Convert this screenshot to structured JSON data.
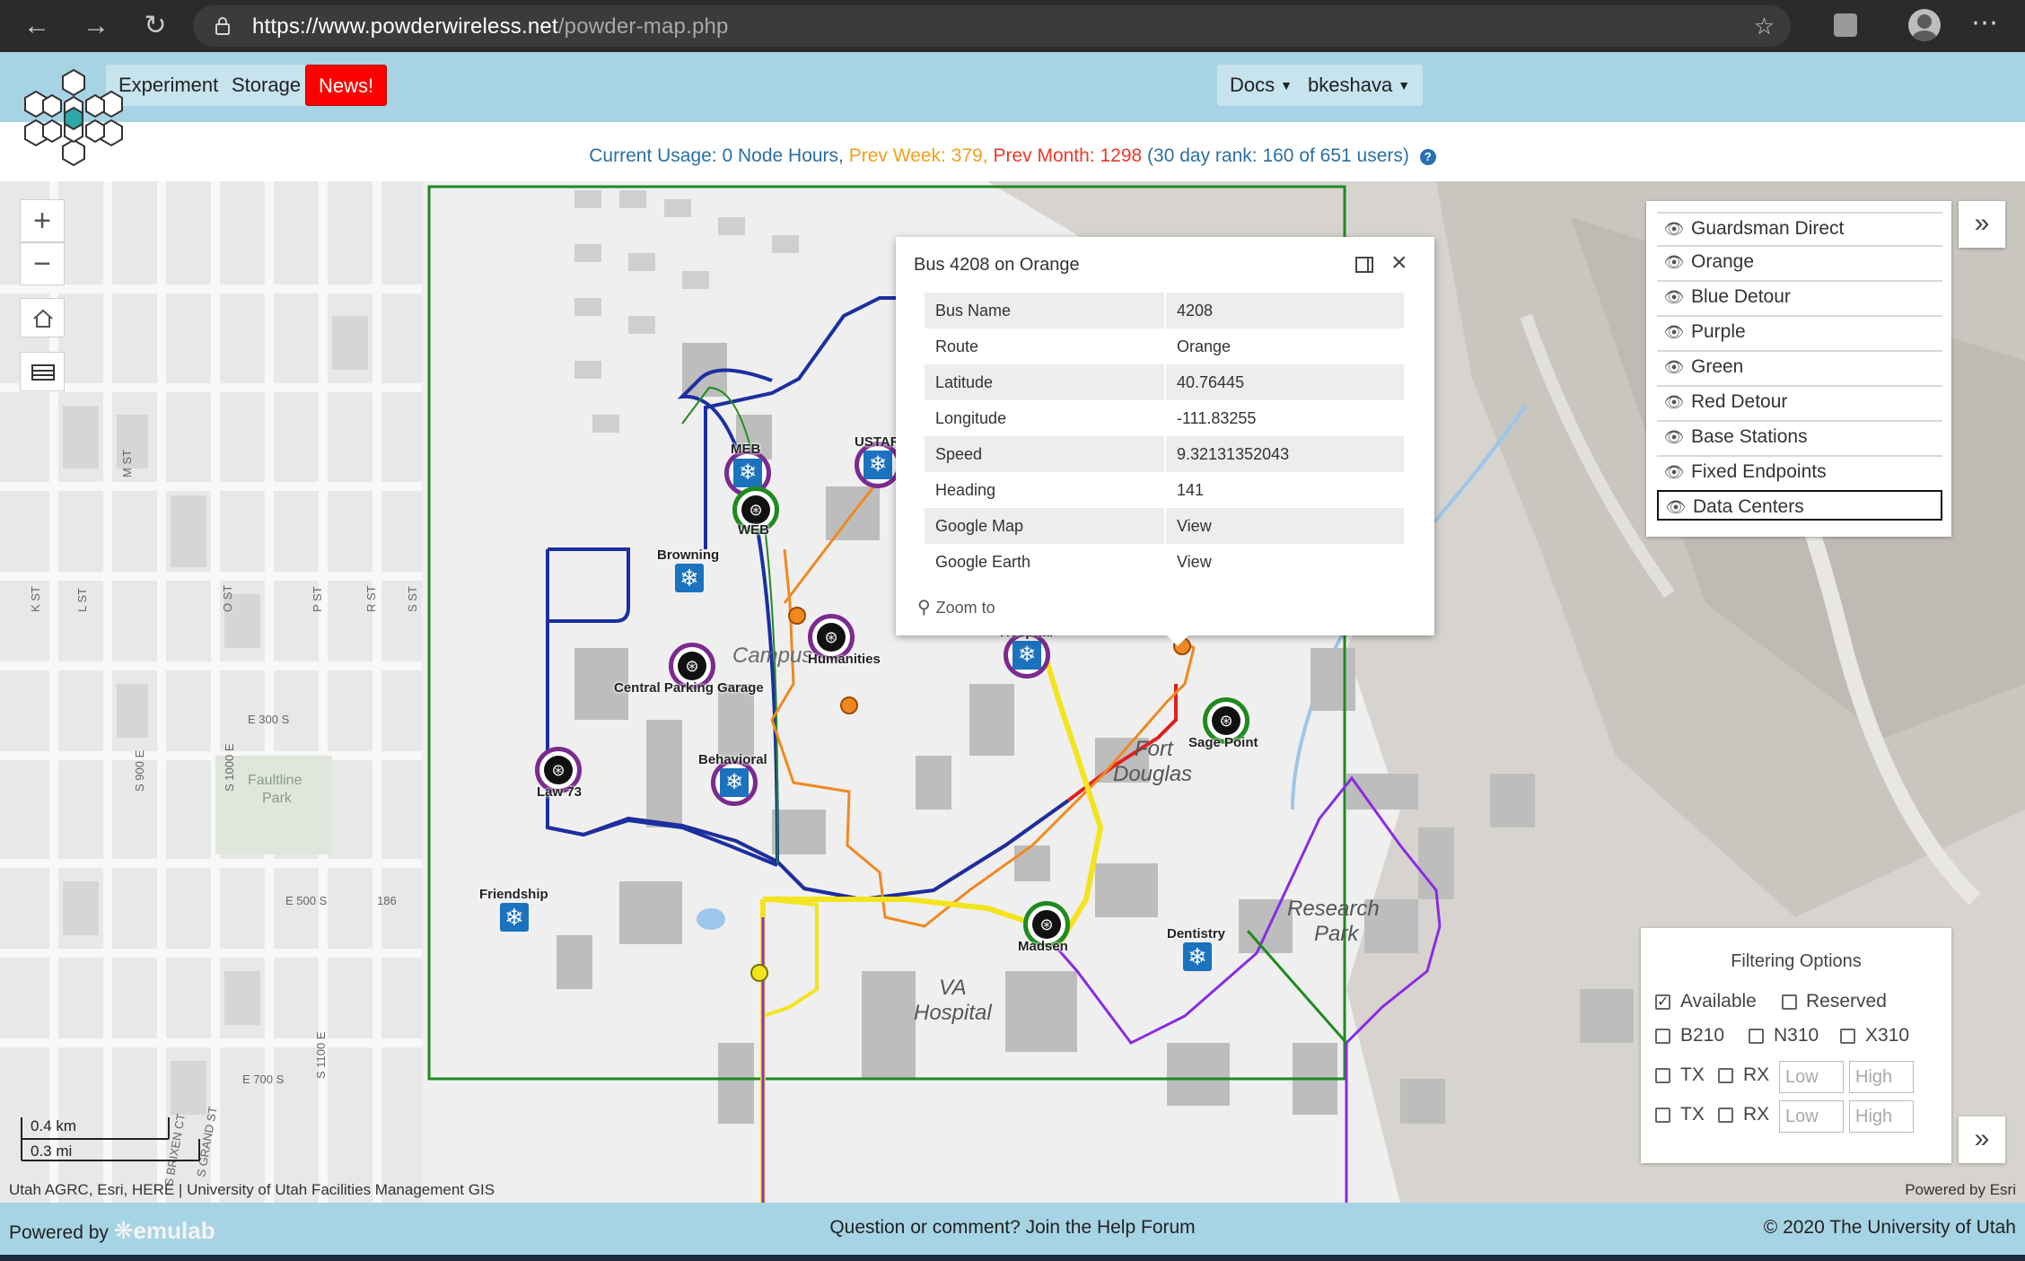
{
  "browser": {
    "url_host": "https://www.powderwireless.net",
    "url_path": "/powder-map.php"
  },
  "nav": {
    "experiments": "Experiments",
    "storage": "Storage",
    "news": "News!",
    "docs": "Docs",
    "user": "bkeshava"
  },
  "usage": {
    "current": "Current Usage: 0 Node Hours,",
    "prev_week": "Prev Week: 379,",
    "prev_month": "Prev Month: 1298",
    "rank": "(30 day rank: 160 of 651 users)"
  },
  "map": {
    "streets": [
      "M ST",
      "L ST",
      "K ST",
      "O ST",
      "P ST",
      "R ST",
      "S ST",
      "S 900 E",
      "S 1000 E",
      "E 300 S",
      "E 500 S",
      "S 1100 E",
      "E 700 S",
      "S BRIXEN CT",
      "S GRAND ST",
      "186"
    ],
    "areas": [
      "Faultline Park",
      "Fort Douglas",
      "Research Park",
      "VA Hospital",
      "Campus"
    ],
    "markers": [
      {
        "label": "MEB",
        "kind": "data-center"
      },
      {
        "label": "WEB",
        "kind": "base-station"
      },
      {
        "label": "USTAR",
        "kind": "data-center"
      },
      {
        "label": "Browning",
        "kind": "data-center"
      },
      {
        "label": "Humanities",
        "kind": "base-station"
      },
      {
        "label": "Central Parking Garage",
        "kind": "base-station"
      },
      {
        "label": "Hospital",
        "kind": "data-center"
      },
      {
        "label": "Sage Point",
        "kind": "base-station"
      },
      {
        "label": "Law 73",
        "kind": "base-station"
      },
      {
        "label": "Behavioral",
        "kind": "data-center"
      },
      {
        "label": "Friendship",
        "kind": "data-center"
      },
      {
        "label": "Madsen",
        "kind": "base-station"
      },
      {
        "label": "Dentistry",
        "kind": "data-center"
      }
    ],
    "scale_km": "0.4 km",
    "scale_mi": "0.3 mi",
    "attribution": "Utah AGRC, Esri, HERE | University of Utah Facilities Management GIS",
    "powered_by_esri": "Powered by Esri"
  },
  "popup": {
    "title": "Bus 4208 on Orange",
    "rows": [
      {
        "k": "Bus Name",
        "v": "4208"
      },
      {
        "k": "Route",
        "v": "Orange"
      },
      {
        "k": "Latitude",
        "v": "40.76445"
      },
      {
        "k": "Longitude",
        "v": "-111.83255"
      },
      {
        "k": "Speed",
        "v": "9.32131352043"
      },
      {
        "k": "Heading",
        "v": "141"
      },
      {
        "k": "Google Map",
        "v": "View"
      },
      {
        "k": "Google Earth",
        "v": "View"
      }
    ],
    "zoom_to": "Zoom to"
  },
  "layers": [
    "Guardsman Direct",
    "Orange",
    "Blue Detour",
    "Purple",
    "Green",
    "Red Detour",
    "Base Stations",
    "Fixed Endpoints",
    "Data Centers"
  ],
  "filter": {
    "title": "Filtering Options",
    "available": "Available",
    "reserved": "Reserved",
    "b210": "B210",
    "n310": "N310",
    "x310": "X310",
    "tx": "TX",
    "rx": "RX",
    "low": "Low",
    "high": "High"
  },
  "footer": {
    "powered_by": "Powered by",
    "emulab": "emulab",
    "help": "Question or comment? Join the Help Forum",
    "copyright": "© 2020 The University of Utah"
  },
  "colors": {
    "header_bg": "#a7d4e4",
    "route_orange": "#f08820",
    "route_blue": "#1a2fa0",
    "route_green": "#1f8a20",
    "route_purple": "#8a2be2",
    "route_yellow": "#f3e41c",
    "route_red": "#e02020",
    "base_station_ring": "#7b2a8e",
    "data_center": "#1b72bd"
  }
}
